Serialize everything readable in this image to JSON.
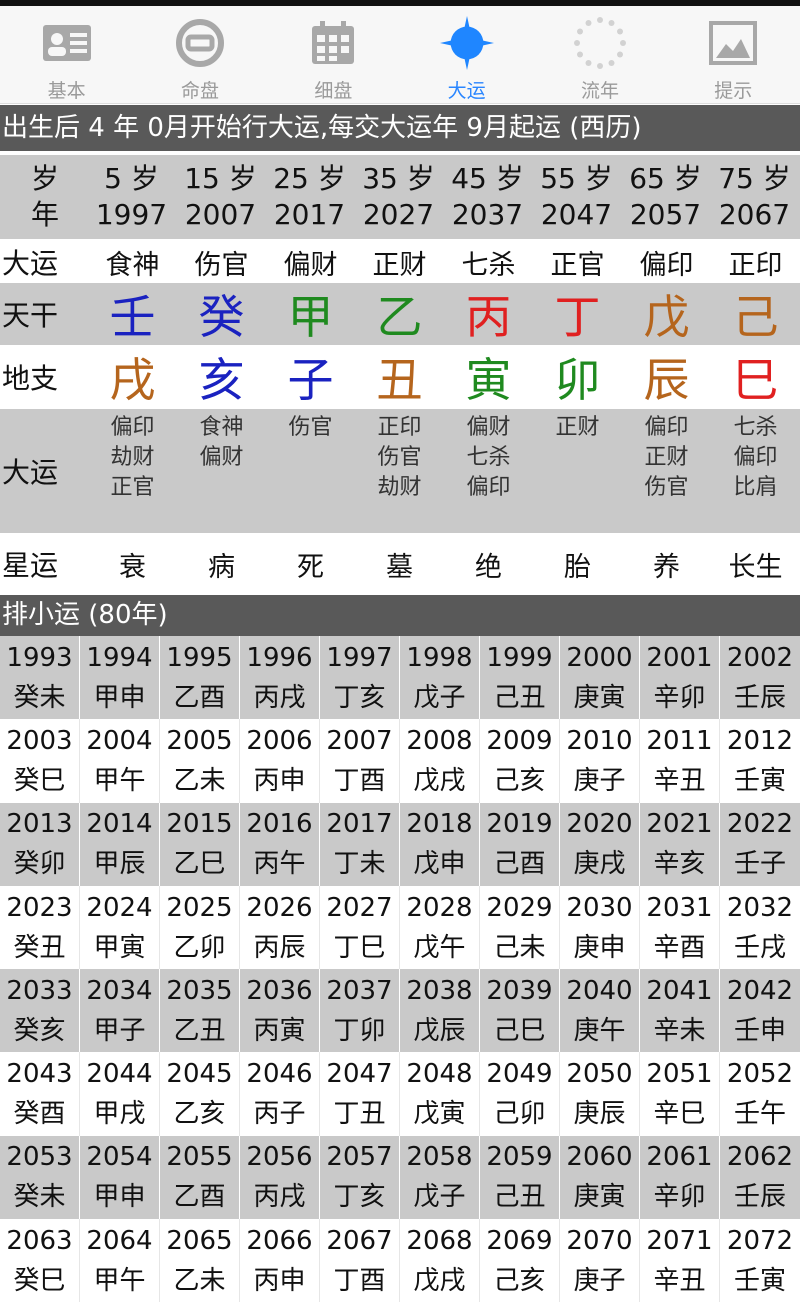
{
  "tabs": [
    {
      "label": "基本",
      "icon": "id-card-icon",
      "active": false
    },
    {
      "label": "命盘",
      "icon": "coin-icon",
      "active": false
    },
    {
      "label": "细盘",
      "icon": "calendar-grid-icon",
      "active": false
    },
    {
      "label": "大运",
      "icon": "compass-star-icon",
      "active": true
    },
    {
      "label": "流年",
      "icon": "loading-ring-icon",
      "active": false
    },
    {
      "label": "提示",
      "icon": "picture-icon",
      "active": false
    }
  ],
  "banner_dayun": "出生后 4 年 0月开始行大运,每交大运年 9月起运 (西历)",
  "age_row": {
    "head_age": "岁",
    "head_year": "年",
    "ages": [
      "5 岁",
      "15 岁",
      "25 岁",
      "35 岁",
      "45 岁",
      "55 岁",
      "65 岁",
      "75 岁"
    ],
    "years": [
      "1997",
      "2007",
      "2017",
      "2027",
      "2037",
      "2047",
      "2057",
      "2067"
    ]
  },
  "dayun_gods": {
    "head": "大运",
    "values": [
      "食神",
      "伤官",
      "偏财",
      "正财",
      "七杀",
      "正官",
      "偏印",
      "正印"
    ]
  },
  "tiangan": {
    "head": "天干",
    "values": [
      "壬",
      "癸",
      "甲",
      "乙",
      "丙",
      "丁",
      "戊",
      "己"
    ],
    "colors": [
      "#1a22c0",
      "#1a22c0",
      "#1f8a1f",
      "#1f8a1f",
      "#e02020",
      "#e02020",
      "#b5651d",
      "#b5651d"
    ]
  },
  "dizhi": {
    "head": "地支",
    "values": [
      "戌",
      "亥",
      "子",
      "丑",
      "寅",
      "卯",
      "辰",
      "巳"
    ],
    "colors": [
      "#b5651d",
      "#1a22c0",
      "#1a22c0",
      "#b5651d",
      "#1f8a1f",
      "#1f8a1f",
      "#b5651d",
      "#e02020"
    ]
  },
  "hidden": {
    "head": "大运",
    "values": [
      [
        "偏印",
        "劫财",
        "正官"
      ],
      [
        "食神",
        "偏财"
      ],
      [
        "伤官"
      ],
      [
        "正印",
        "伤官",
        "劫财"
      ],
      [
        "偏财",
        "七杀",
        "偏印"
      ],
      [
        "正财"
      ],
      [
        "偏印",
        "正财",
        "伤官"
      ],
      [
        "七杀",
        "偏印",
        "比肩"
      ]
    ]
  },
  "xingyun": {
    "head": "星运",
    "values": [
      "衰",
      "病",
      "死",
      "墓",
      "绝",
      "胎",
      "养",
      "长生"
    ]
  },
  "banner_xiaoyun": "排小运 (80年)",
  "xiaoyun": [
    {
      "years": [
        "1993",
        "1994",
        "1995",
        "1996",
        "1997",
        "1998",
        "1999",
        "2000",
        "2001",
        "2002"
      ],
      "gz": [
        "癸未",
        "甲申",
        "乙酉",
        "丙戌",
        "丁亥",
        "戊子",
        "己丑",
        "庚寅",
        "辛卯",
        "壬辰"
      ]
    },
    {
      "years": [
        "2003",
        "2004",
        "2005",
        "2006",
        "2007",
        "2008",
        "2009",
        "2010",
        "2011",
        "2012"
      ],
      "gz": [
        "癸巳",
        "甲午",
        "乙未",
        "丙申",
        "丁酉",
        "戊戌",
        "己亥",
        "庚子",
        "辛丑",
        "壬寅"
      ]
    },
    {
      "years": [
        "2013",
        "2014",
        "2015",
        "2016",
        "2017",
        "2018",
        "2019",
        "2020",
        "2021",
        "2022"
      ],
      "gz": [
        "癸卯",
        "甲辰",
        "乙巳",
        "丙午",
        "丁未",
        "戊申",
        "己酉",
        "庚戌",
        "辛亥",
        "壬子"
      ]
    },
    {
      "years": [
        "2023",
        "2024",
        "2025",
        "2026",
        "2027",
        "2028",
        "2029",
        "2030",
        "2031",
        "2032"
      ],
      "gz": [
        "癸丑",
        "甲寅",
        "乙卯",
        "丙辰",
        "丁巳",
        "戊午",
        "己未",
        "庚申",
        "辛酉",
        "壬戌"
      ]
    },
    {
      "years": [
        "2033",
        "2034",
        "2035",
        "2036",
        "2037",
        "2038",
        "2039",
        "2040",
        "2041",
        "2042"
      ],
      "gz": [
        "癸亥",
        "甲子",
        "乙丑",
        "丙寅",
        "丁卯",
        "戊辰",
        "己巳",
        "庚午",
        "辛未",
        "壬申"
      ]
    },
    {
      "years": [
        "2043",
        "2044",
        "2045",
        "2046",
        "2047",
        "2048",
        "2049",
        "2050",
        "2051",
        "2052"
      ],
      "gz": [
        "癸酉",
        "甲戌",
        "乙亥",
        "丙子",
        "丁丑",
        "戊寅",
        "己卯",
        "庚辰",
        "辛巳",
        "壬午"
      ]
    },
    {
      "years": [
        "2053",
        "2054",
        "2055",
        "2056",
        "2057",
        "2058",
        "2059",
        "2060",
        "2061",
        "2062"
      ],
      "gz": [
        "癸未",
        "甲申",
        "乙酉",
        "丙戌",
        "丁亥",
        "戊子",
        "己丑",
        "庚寅",
        "辛卯",
        "壬辰"
      ]
    },
    {
      "years": [
        "2063",
        "2064",
        "2065",
        "2066",
        "2067",
        "2068",
        "2069",
        "2070",
        "2071",
        "2072"
      ],
      "gz": [
        "癸巳",
        "甲午",
        "乙未",
        "丙申",
        "丁酉",
        "戊戌",
        "己亥",
        "庚子",
        "辛丑",
        "壬寅"
      ]
    }
  ]
}
